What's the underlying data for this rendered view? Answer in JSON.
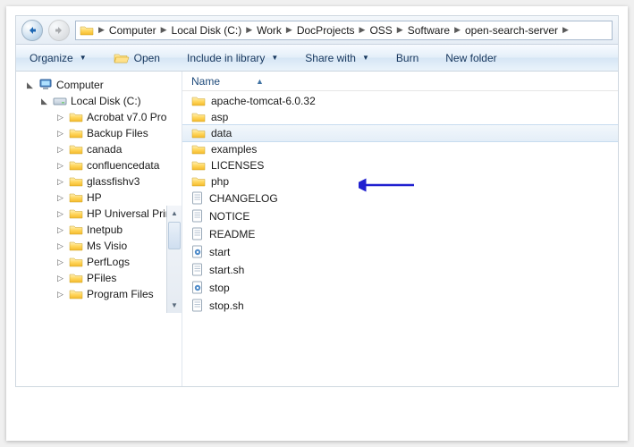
{
  "breadcrumb": [
    "Computer",
    "Local Disk (C:)",
    "Work",
    "DocProjects",
    "OSS",
    "Software",
    "open-search-server"
  ],
  "toolbar": {
    "organize": "Organize",
    "open": "Open",
    "include": "Include in library",
    "share": "Share with",
    "burn": "Burn",
    "newfolder": "New folder"
  },
  "tree": {
    "root": "Computer",
    "disk": "Local Disk (C:)",
    "items": [
      "Acrobat v7.0 Pro",
      "Backup Files",
      "canada",
      "confluencedata",
      "glassfishv3",
      "HP",
      "HP Universal Print",
      "Inetpub",
      "Ms Visio",
      "PerfLogs",
      "PFiles",
      "Program Files"
    ]
  },
  "column": {
    "name": "Name"
  },
  "files": [
    {
      "name": "apache-tomcat-6.0.32",
      "type": "folder"
    },
    {
      "name": "asp",
      "type": "folder"
    },
    {
      "name": "data",
      "type": "folder",
      "selected": true
    },
    {
      "name": "examples",
      "type": "folder"
    },
    {
      "name": "LICENSES",
      "type": "folder"
    },
    {
      "name": "php",
      "type": "folder"
    },
    {
      "name": "CHANGELOG",
      "type": "file"
    },
    {
      "name": "NOTICE",
      "type": "file"
    },
    {
      "name": "README",
      "type": "file"
    },
    {
      "name": "start",
      "type": "bat"
    },
    {
      "name": "start.sh",
      "type": "file"
    },
    {
      "name": "stop",
      "type": "bat"
    },
    {
      "name": "stop.sh",
      "type": "file"
    }
  ]
}
